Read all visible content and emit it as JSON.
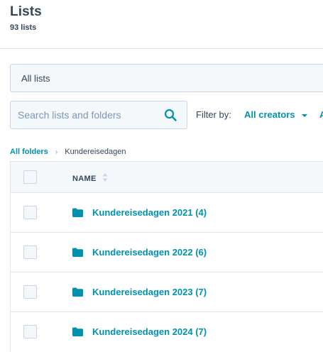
{
  "header": {
    "title": "Lists",
    "count_label": "93 lists"
  },
  "view": {
    "tab_label": "All lists"
  },
  "search": {
    "placeholder": "Search lists and folders",
    "value": ""
  },
  "filter": {
    "label": "Filter by:",
    "creator_value": "All creators",
    "overflow_text": "A"
  },
  "breadcrumb": {
    "root": "All folders",
    "separator": "›",
    "current": "Kundereisedagen"
  },
  "table": {
    "column_name": "NAME",
    "rows": [
      {
        "label": "Kundereisedagen 2021 (4)"
      },
      {
        "label": "Kundereisedagen 2022 (6)"
      },
      {
        "label": "Kundereisedagen 2023 (7)"
      },
      {
        "label": "Kundereisedagen 2024 (7)"
      }
    ]
  },
  "colors": {
    "accent": "#0091ae",
    "text": "#33475b",
    "border": "#cbd6e2",
    "surface": "#f5f8fa"
  },
  "icons": {
    "search": "search-icon",
    "sort": "sort-icon",
    "folder": "folder-icon",
    "dropdown": "caret-down-icon"
  }
}
